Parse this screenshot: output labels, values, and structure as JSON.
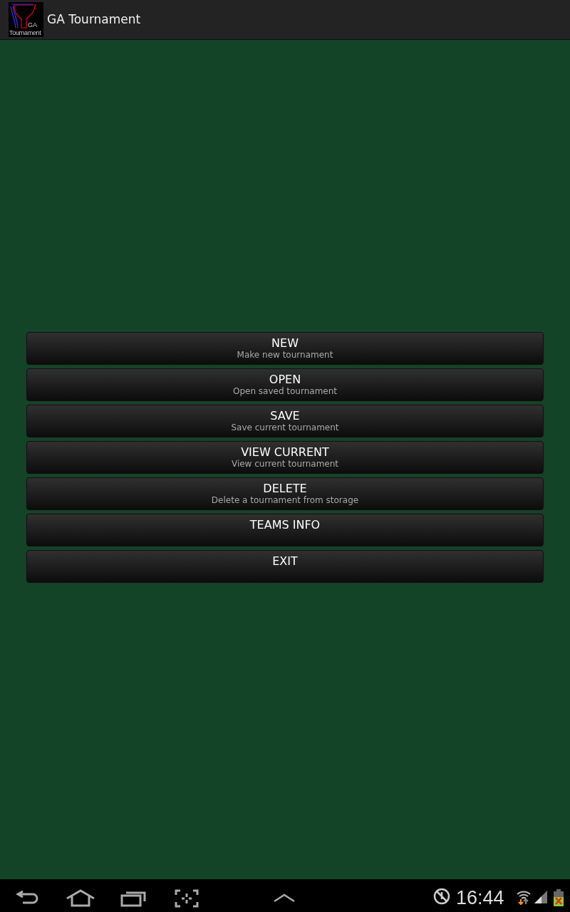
{
  "action_bar": {
    "logo_text": [
      "GA",
      "Tournament"
    ],
    "title": "GA Tournament"
  },
  "menu": [
    {
      "title": "NEW",
      "subtitle": "Make new tournament"
    },
    {
      "title": "OPEN",
      "subtitle": "Open saved tournament"
    },
    {
      "title": "SAVE",
      "subtitle": "Save current tournament"
    },
    {
      "title": "VIEW CURRENT",
      "subtitle": "View current tournament"
    },
    {
      "title": "DELETE",
      "subtitle": "Delete a tournament from storage"
    },
    {
      "title": "TEAMS INFO"
    },
    {
      "title": "EXIT"
    }
  ],
  "system_bar": {
    "clock": "16:44"
  }
}
